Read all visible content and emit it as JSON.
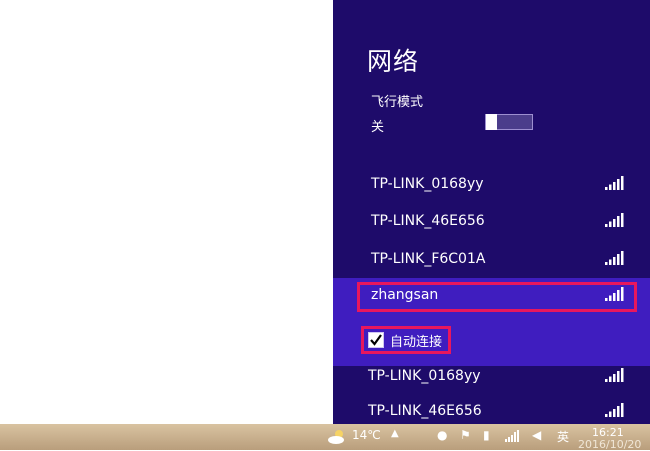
{
  "network_panel": {
    "title": "网络",
    "airplane_mode": {
      "label": "飞行模式",
      "state": "关"
    },
    "networks": [
      {
        "ssid": "TP-LINK_0168yy",
        "signal_bars": 5
      },
      {
        "ssid": "TP-LINK_46E656",
        "signal_bars": 5
      },
      {
        "ssid": "TP-LINK_F6C01A",
        "signal_bars": 5
      },
      {
        "ssid": "zhangsan",
        "signal_bars": 5,
        "selected": true
      },
      {
        "ssid": "TP-LINK_0168yy",
        "signal_bars": 5
      },
      {
        "ssid": "TP-LINK_46E656",
        "signal_bars": 5
      }
    ],
    "auto_connect": {
      "label": "自动连接",
      "checked": true
    }
  },
  "taskbar": {
    "weather": "14℃",
    "clock": "16:21",
    "date": "2016/10/20",
    "ime": "英"
  },
  "colors": {
    "panel_bg": "#1e0b6a",
    "selected_bg": "#3f1dbf",
    "highlight": "#e8175d"
  }
}
